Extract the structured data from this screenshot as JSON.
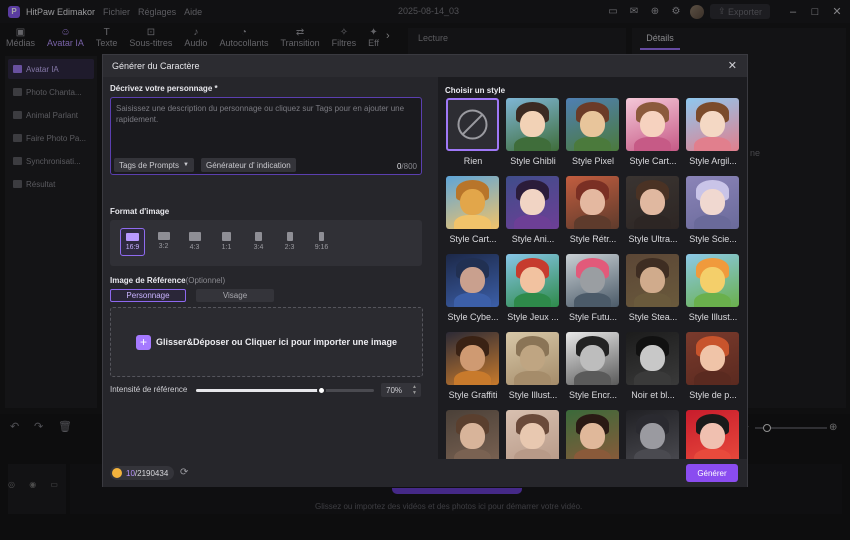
{
  "app": {
    "name": "HitPaw Edimakor",
    "menu": [
      "Fichier",
      "Réglages",
      "Aide"
    ],
    "date": "2025-08-14_03",
    "export_label": "Exporter"
  },
  "toolbar": {
    "tabs": [
      {
        "label": "Médias",
        "icon": "media-icon"
      },
      {
        "label": "Avatar IA",
        "icon": "avatar-icon",
        "active": true
      },
      {
        "label": "Texte",
        "icon": "text-icon"
      },
      {
        "label": "Sous-titres",
        "icon": "subtitles-icon"
      },
      {
        "label": "Audio",
        "icon": "music-icon"
      },
      {
        "label": "Autocollants",
        "icon": "sticker-icon"
      },
      {
        "label": "Transition",
        "icon": "transition-icon"
      },
      {
        "label": "Filtres",
        "icon": "filter-icon"
      },
      {
        "label": "Eff",
        "icon": "effects-icon"
      }
    ]
  },
  "sidebar": {
    "items": [
      {
        "label": "Avatar IA",
        "active": true
      },
      {
        "label": "Photo Chanta..."
      },
      {
        "label": "Animal Parlant"
      },
      {
        "label": "Faire Photo Pa..."
      },
      {
        "label": "Synchronisati..."
      },
      {
        "label": "Résultat"
      }
    ]
  },
  "preview": {
    "label": "Lecture"
  },
  "details": {
    "tab_label": "Détails",
    "fragment": "ne"
  },
  "timeline": {
    "drop_hint": "Glissez ou importez des vidéos et des photos ici pour démarrer votre vidéo."
  },
  "modal": {
    "title": "Générer du Caractère",
    "describe_label": "Décrivez votre personnage *",
    "describe_placeholder": "Saisissez une description du personnage ou cliquez sur Tags pour en ajouter une rapidement.",
    "tags_button": "Tags de Prompts",
    "generator_button": "Générateur d' indication",
    "char_count": "0",
    "char_max": "/800",
    "format_label": "Format d'image",
    "ratios": [
      {
        "label": "16:9",
        "active": true
      },
      {
        "label": "3:2"
      },
      {
        "label": "4:3"
      },
      {
        "label": "1:1"
      },
      {
        "label": "3:4"
      },
      {
        "label": "2:3"
      },
      {
        "label": "9:16"
      }
    ],
    "reference_label": "Image de Référence",
    "reference_optional": "(Optionnel)",
    "ref_tab_person": "Personnage",
    "ref_tab_face": "Visage",
    "upload_text": "Glisser&Déposer ou Cliquer ici pour importer une image",
    "intensity_label": "Intensité de référence",
    "intensity_value": "70%",
    "intensity": 0.7,
    "style_heading": "Choisir un style",
    "styles": [
      "Rien",
      "Style Ghibli",
      "Style Pixel",
      "Style Cart...",
      "Style Argil...",
      "Style Cart...",
      "Style Ani...",
      "Style Rétr...",
      "Style Ultra...",
      "Style Scie...",
      "Style Cybe...",
      "Style Jeux ...",
      "Style Futu...",
      "Style Stea...",
      "Style Illust...",
      "Style Graffiti",
      "Style Illust...",
      "Style Encr...",
      "Noir et bl...",
      "Style de p...",
      "",
      "",
      "",
      "",
      ""
    ],
    "credits_used": "10",
    "credits_total": "/2190434",
    "generate_label": "Générer"
  }
}
